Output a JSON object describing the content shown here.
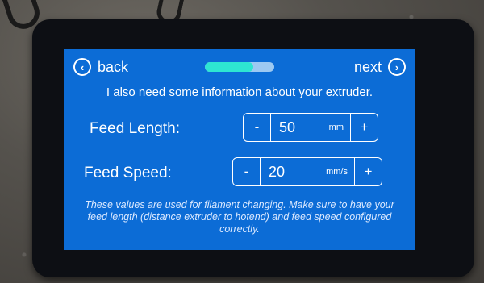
{
  "nav": {
    "back_label": "back",
    "back_icon": "chevron-left-icon",
    "next_label": "next",
    "next_icon": "chevron-right-icon",
    "progress_fraction": 0.7
  },
  "subtitle": "I also need some information about your extruder.",
  "feed_length": {
    "label": "Feed Length:",
    "minus": "-",
    "value": "50",
    "unit": "mm",
    "plus": "+"
  },
  "feed_speed": {
    "label": "Feed Speed:",
    "minus": "-",
    "value": "20",
    "unit": "mm/s",
    "plus": "+"
  },
  "hint": "These values are used for filament changing. Make sure to have your feed length (distance extruder to hotend) and feed speed configured correctly.",
  "colors": {
    "screen_background": "#0c6cd6",
    "progress_track": "#9dc9f2",
    "progress_fill": "#2ee6d2",
    "text": "#ffffff"
  }
}
